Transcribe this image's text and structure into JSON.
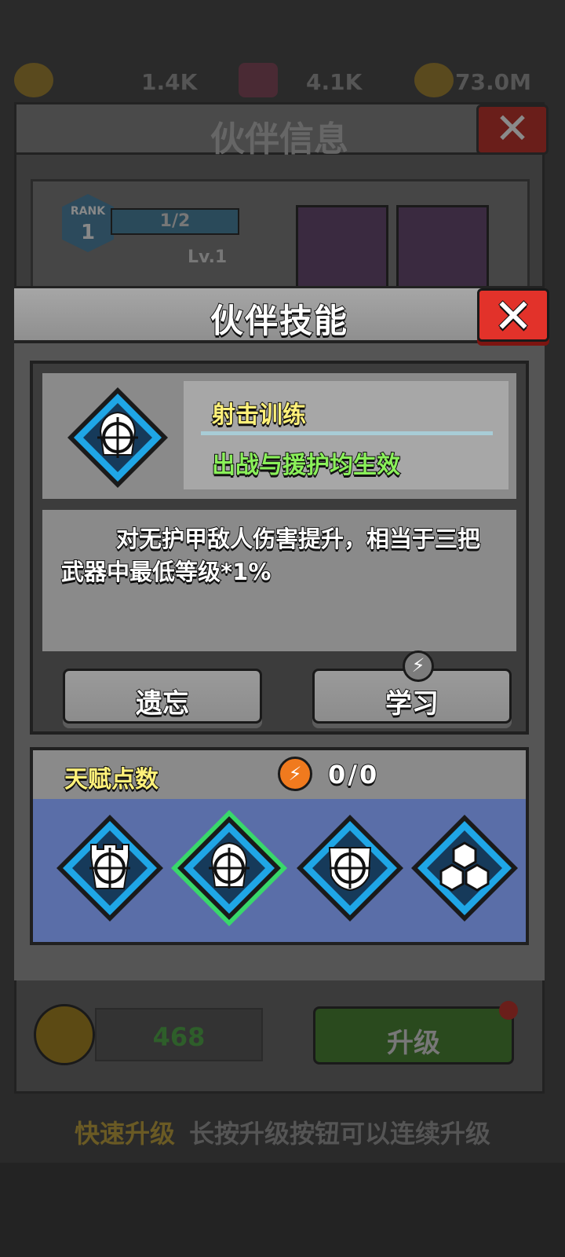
{
  "background": {
    "stats": [
      "1.4K",
      "4.1K",
      "73.0M"
    ],
    "panel_title": "伙伴信息",
    "close_glyph": "✕",
    "rank_label": "RANK",
    "rank_value": "1",
    "progress": "1/2",
    "level": "Lv.1",
    "gold": "468",
    "upgrade_label": "升级",
    "tip_key": "快速升级",
    "tip_text": "长按升级按钮可以连续升级"
  },
  "modal": {
    "title": "伙伴技能",
    "close_glyph": "✕",
    "skill": {
      "icon": "crosshair-armor-icon",
      "name": "射击训练",
      "effect": "出战与援护均生效",
      "description": "对无护甲敌人伤害提升，相当于三把武器中最低等级*1%"
    },
    "buttons": {
      "forget": "遗忘",
      "learn": "学习",
      "learn_icon": "lightning-icon"
    },
    "talent": {
      "label": "天赋点数",
      "points": "0/0",
      "points_icon": "lightning-coin-icon",
      "items": [
        {
          "icon": "tower-crosshair-icon",
          "selected": false
        },
        {
          "icon": "crosshair-armor-icon",
          "selected": true
        },
        {
          "icon": "shield-crosshair-icon",
          "selected": false
        },
        {
          "icon": "hexagon-cluster-icon",
          "selected": false
        }
      ]
    }
  },
  "colors": {
    "close_red": "#e2322a",
    "skill_name": "#fff17a",
    "skill_effect": "#8af05a",
    "talent_bg": "#5a6ea8",
    "diamond_blue": "#1fa6e6",
    "selected_green": "#38d86a",
    "points_orange": "#f07a1e"
  }
}
